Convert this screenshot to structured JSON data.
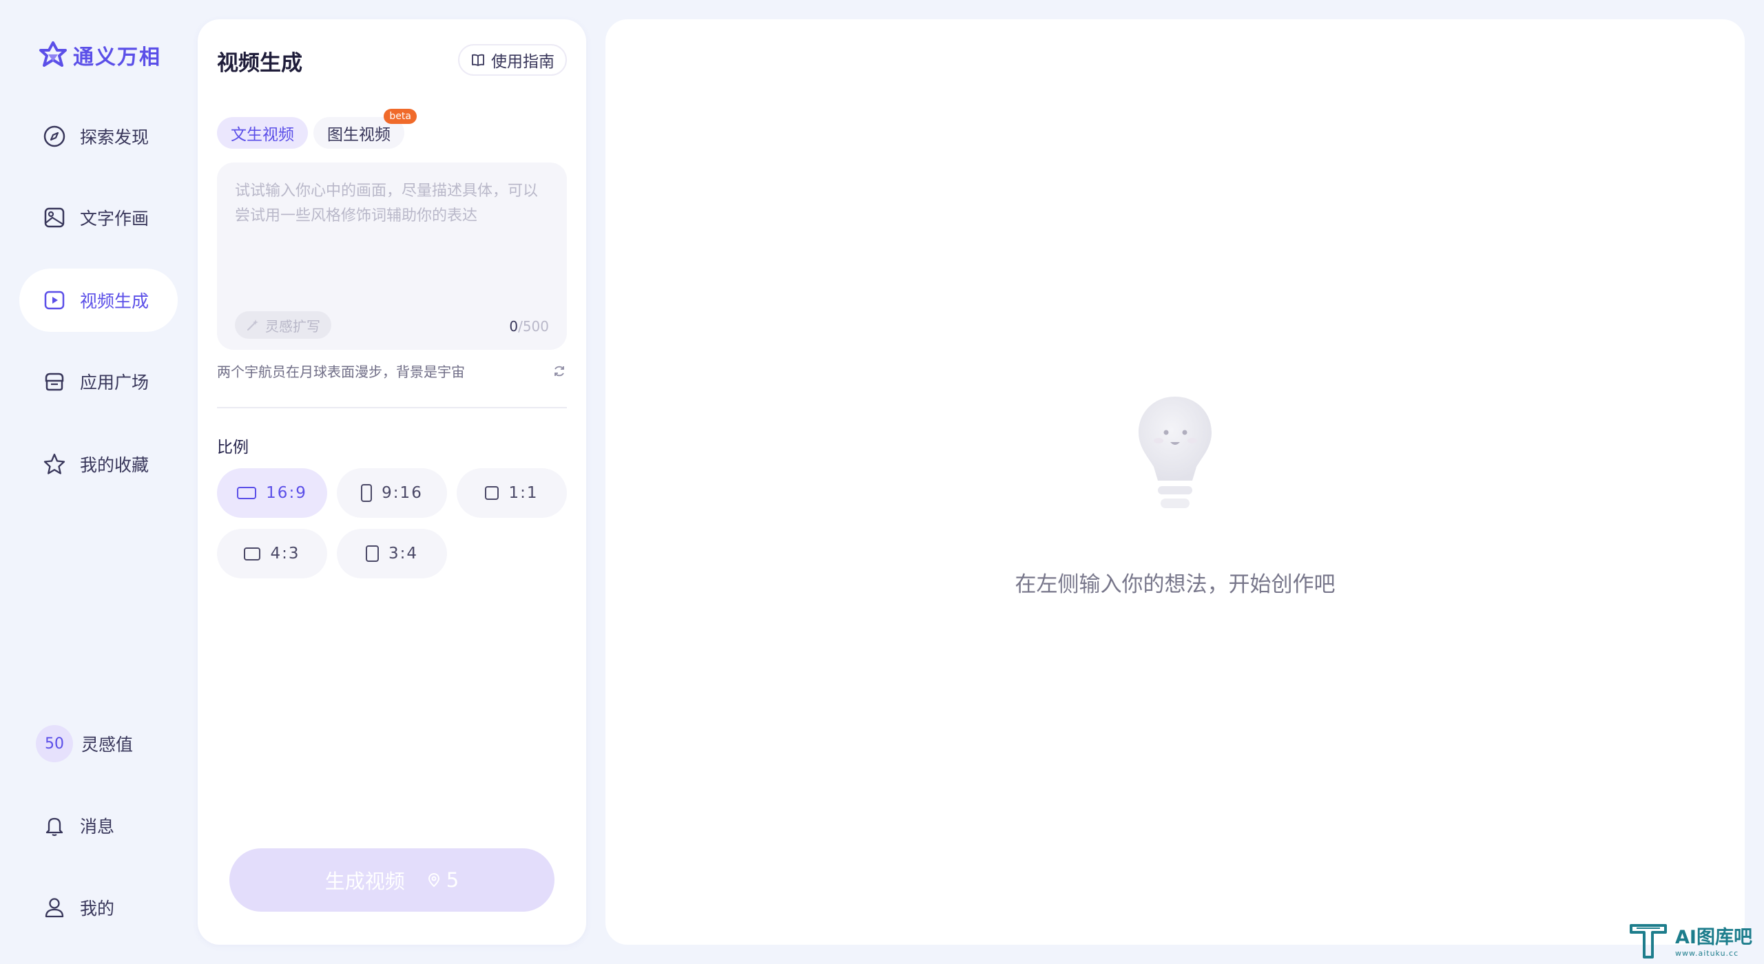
{
  "brand": {
    "name": "通义万相",
    "color": "#5b4fe8"
  },
  "sidebar": {
    "items": [
      {
        "label": "探索发现",
        "icon": "compass-icon"
      },
      {
        "label": "文字作画",
        "icon": "image-frame-icon"
      },
      {
        "label": "视频生成",
        "icon": "video-play-icon",
        "active": true
      },
      {
        "label": "应用广场",
        "icon": "store-icon"
      },
      {
        "label": "我的收藏",
        "icon": "star-icon"
      }
    ],
    "points": {
      "value": "50",
      "label": "灵感值"
    },
    "messages_label": "消息",
    "profile_label": "我的"
  },
  "panel": {
    "title": "视频生成",
    "guide_label": "使用指南",
    "tabs": [
      {
        "label": "文生视频",
        "active": true
      },
      {
        "label": "图生视频",
        "badge": "beta"
      }
    ],
    "prompt": {
      "placeholder": "试试输入你心中的画面，尽量描述具体，可以尝试用一些风格修饰词辅助你的表达",
      "value": "",
      "inspire_label": "灵感扩写",
      "count": "0",
      "max": "/500"
    },
    "suggestion": "两个宇航员在月球表面漫步，背景是宇宙",
    "ratio_label": "比例",
    "ratios": [
      {
        "label": "16:9",
        "active": true
      },
      {
        "label": "9:16"
      },
      {
        "label": "1:1"
      },
      {
        "label": "4:3"
      },
      {
        "label": "3:4"
      }
    ],
    "generate": {
      "label": "生成视频",
      "cost": "5"
    }
  },
  "main": {
    "empty_text": "在左侧输入你的想法，开始创作吧"
  },
  "watermark": {
    "title": "AI图库吧",
    "url": "www.aituku.cc"
  }
}
